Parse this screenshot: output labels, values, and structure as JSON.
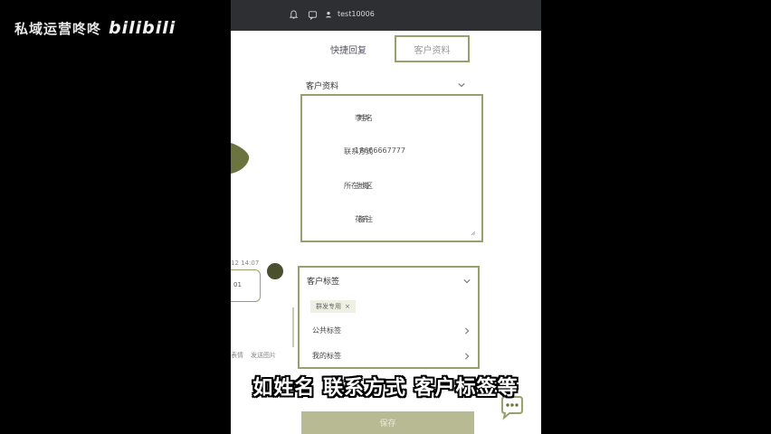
{
  "watermark": {
    "channel": "私域运营咚咚",
    "logo": "bilibili"
  },
  "topbar": {
    "username": "test10006",
    "icons": [
      "bell-icon",
      "message-icon",
      "user-icon"
    ]
  },
  "tabs": [
    {
      "label": "快捷回复",
      "active": false
    },
    {
      "label": "客户资料",
      "active": true
    }
  ],
  "profile": {
    "section_title": "客户资料",
    "fields": [
      {
        "label": "姓名",
        "value": "李华"
      },
      {
        "label": "联系方式",
        "value": "18666667777"
      },
      {
        "label": "所在地区",
        "value": "上海"
      },
      {
        "label": "备注",
        "value": "花卉"
      }
    ]
  },
  "tags": {
    "section_title": "客户标签",
    "chips": [
      {
        "label": "群发专用",
        "remove": "×"
      }
    ],
    "public_label": "公共标签",
    "private_label": "我的标签"
  },
  "chat_fragments": {
    "time": "12 14:07",
    "bubble_text": "01",
    "tools": [
      "表情",
      "发送图片"
    ]
  },
  "save_button": {
    "label": "保存"
  },
  "caption": "如姓名 联系方式 客户标签等",
  "colors": {
    "accent": "#9aa06c",
    "topbar": "#2d2f33",
    "button": "#b7ba93"
  }
}
